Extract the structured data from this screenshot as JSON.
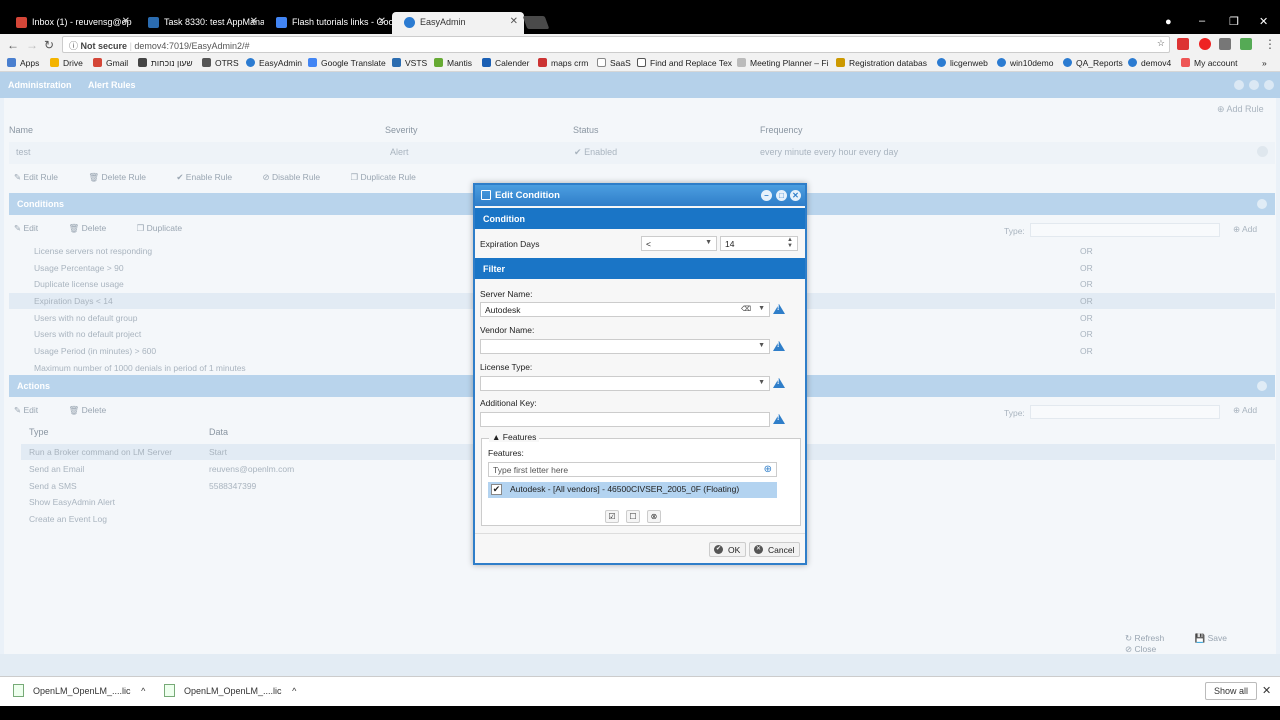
{
  "browser": {
    "tabs": [
      {
        "title": "Inbox (1) - reuvensg@op",
        "color": "#d44638"
      },
      {
        "title": "Task 8330: test AppMana",
        "color": "#2b6cb0"
      },
      {
        "title": "Flash tutorials links - Goo",
        "color": "#4285f4"
      },
      {
        "title": "EasyAdmin",
        "color": "#2b7bd1"
      }
    ],
    "not_secure": "Not secure",
    "url": "demov4:7019/EasyAdmin2/#",
    "bookmarks": [
      "Apps",
      "Drive",
      "Gmail",
      "שעון נוכחות",
      "OTRS",
      "EasyAdmin",
      "Google Translate",
      "VSTS",
      "Mantis",
      "Calender",
      "maps crm",
      "SaaS",
      "Find and Replace Tex",
      "Meeting Planner – Fi",
      "Registration databas",
      "licgenweb",
      "win10demo",
      "QA_Reports",
      "demov4",
      "My account"
    ]
  },
  "app": {
    "title": "Administration",
    "breadcrumb": "Alert Rules",
    "add_rule": "Add Rule",
    "rule_columns": [
      "Name",
      "Severity",
      "Status",
      "Frequency"
    ],
    "rule_row": {
      "name": "test",
      "severity": "Alert",
      "status": "Enabled",
      "frequency": "every minute every hour every day"
    },
    "rule_buttons": [
      "Edit Rule",
      "Delete Rule",
      "Enable Rule",
      "Disable Rule",
      "Duplicate Rule"
    ],
    "conditions_title": "Conditions",
    "condition_buttons": [
      "Edit",
      "Delete",
      "Duplicate"
    ],
    "type_label": "Type:",
    "add_label": "Add",
    "conditions": [
      {
        "text": "License servers not responding",
        "or": "OR"
      },
      {
        "text": "Usage Percentage > 90",
        "or": "OR"
      },
      {
        "text": "Duplicate license usage",
        "or": "OR"
      },
      {
        "text": "Expiration Days < 14",
        "or": "OR"
      },
      {
        "text": "Users with no default group",
        "or": "OR"
      },
      {
        "text": "Users with no default project",
        "or": "OR"
      },
      {
        "text": "Usage Period (in minutes) > 600",
        "or": "OR"
      },
      {
        "text": "Maximum number of 1000 denials in period of 1 minutes",
        "or": ""
      }
    ],
    "actions_title": "Actions",
    "action_buttons": [
      "Edit",
      "Delete"
    ],
    "action_columns": [
      "Type",
      "Data"
    ],
    "actions": [
      {
        "type": "Run a Broker command on LM Server",
        "data": "Start"
      },
      {
        "type": "Send an Email",
        "data": "reuvens@openlm.com"
      },
      {
        "type": "Send a SMS",
        "data": "5588347399"
      },
      {
        "type": "Show EasyAdmin Alert",
        "data": ""
      },
      {
        "type": "Create an Event Log",
        "data": ""
      }
    ],
    "footer_buttons": [
      "Refresh",
      "Save",
      "Close"
    ]
  },
  "modal": {
    "title": "Edit Condition",
    "condition_header": "Condition",
    "expiration_label": "Expiration Days",
    "operator": "<",
    "days_value": "14",
    "filter_header": "Filter",
    "server_name_label": "Server Name:",
    "server_name_value": "Autodesk",
    "vendor_name_label": "Vendor Name:",
    "license_type_label": "License Type:",
    "additional_key_label": "Additional Key:",
    "features_legend": "Features",
    "features_label": "Features:",
    "features_placeholder": "Type first letter here",
    "feature_item": "Autodesk - [All vendors] - 46500CIVSER_2005_0F (Floating)",
    "ok": "OK",
    "cancel": "Cancel"
  },
  "downloads": {
    "items": [
      "OpenLM_OpenLM_....lic",
      "OpenLM_OpenLM_....lic"
    ],
    "show_all": "Show all"
  }
}
